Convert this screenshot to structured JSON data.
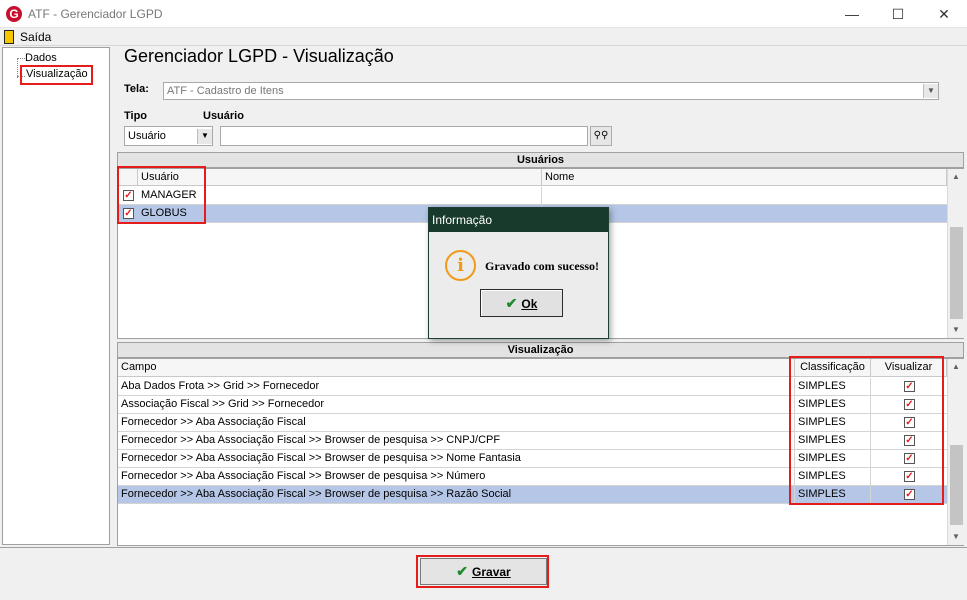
{
  "window": {
    "title": "ATF - Gerenciador LGPD",
    "logo_letter": "G",
    "min_glyph": "—",
    "max_glyph": "☐",
    "close_glyph": "✕"
  },
  "menu": {
    "exit_label": "Saída"
  },
  "tree": {
    "items": [
      "Dados",
      "Visualização"
    ]
  },
  "header": {
    "title": "Gerenciador LGPD - Visualização"
  },
  "tela": {
    "label": "Tela:",
    "value": "ATF - Cadastro de Itens"
  },
  "filters": {
    "tipo_label": "Tipo",
    "usuario_label": "Usuário",
    "tipo_value": "Usuário",
    "usuario_value": ""
  },
  "users_section": {
    "title": "Usuários",
    "columns": [
      "Usuário",
      "Nome"
    ],
    "rows": [
      {
        "user": "MANAGER",
        "name": "",
        "checked": true
      },
      {
        "user": "GLOBUS",
        "name": "",
        "checked": true
      }
    ]
  },
  "view_section": {
    "title": "Visualização",
    "columns": [
      "Campo",
      "Classificação",
      "Visualizar"
    ],
    "rows": [
      {
        "campo": "Aba Dados Frota >> Grid >> Fornecedor",
        "classificacao": "SIMPLES",
        "visualizar": true
      },
      {
        "campo": "Associação Fiscal >> Grid >> Fornecedor",
        "classificacao": "SIMPLES",
        "visualizar": true
      },
      {
        "campo": "Fornecedor >> Aba Associação Fiscal",
        "classificacao": "SIMPLES",
        "visualizar": true
      },
      {
        "campo": "Fornecedor >> Aba Associação Fiscal >> Browser de pesquisa >> CNPJ/CPF",
        "classificacao": "SIMPLES",
        "visualizar": true
      },
      {
        "campo": "Fornecedor >> Aba Associação Fiscal >> Browser de pesquisa >> Nome Fantasia",
        "classificacao": "SIMPLES",
        "visualizar": true
      },
      {
        "campo": "Fornecedor >> Aba Associação Fiscal >> Browser de pesquisa >> Número",
        "classificacao": "SIMPLES",
        "visualizar": true
      },
      {
        "campo": "Fornecedor >> Aba Associação Fiscal >> Browser de pesquisa >> Razão Social",
        "classificacao": "SIMPLES",
        "visualizar": true
      }
    ]
  },
  "dialog": {
    "title": "Informação",
    "message": "Gravado com sucesso!",
    "ok_label": "Ok",
    "icon": "info-icon"
  },
  "footer": {
    "save_label": "Gravar"
  },
  "colors": {
    "highlight": "#e41c1c",
    "selection": "#b5c6e7",
    "dialog_title_bg": "#173a2c",
    "success": "#1f8a2e"
  }
}
